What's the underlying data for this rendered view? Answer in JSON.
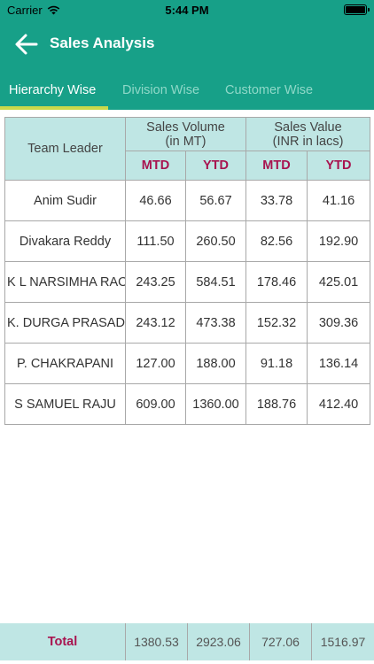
{
  "status": {
    "carrier": "Carrier",
    "time": "5:44 PM"
  },
  "header": {
    "title": "Sales Analysis"
  },
  "tabs": [
    {
      "label": "Hierarchy Wise"
    },
    {
      "label": "Division Wise"
    },
    {
      "label": "Customer Wise"
    }
  ],
  "table": {
    "team_leader_header": "Team Leader",
    "volume_header_line1": "Sales Volume",
    "volume_header_line2": "(in MT)",
    "value_header_line1": "Sales Value",
    "value_header_line2": "(INR in lacs)",
    "mtd_label": "MTD",
    "ytd_label": "YTD",
    "rows": [
      {
        "name": "Anim Sudir",
        "vol_mtd": "46.66",
        "vol_ytd": "56.67",
        "val_mtd": "33.78",
        "val_ytd": "41.16"
      },
      {
        "name": "Divakara Reddy",
        "vol_mtd": "111.50",
        "vol_ytd": "260.50",
        "val_mtd": "82.56",
        "val_ytd": "192.90"
      },
      {
        "name": "K L NARSIMHA RAO",
        "vol_mtd": "243.25",
        "vol_ytd": "584.51",
        "val_mtd": "178.46",
        "val_ytd": "425.01"
      },
      {
        "name": "K. DURGA PRASAD",
        "vol_mtd": "243.12",
        "vol_ytd": "473.38",
        "val_mtd": "152.32",
        "val_ytd": "309.36"
      },
      {
        "name": "P. CHAKRAPANI",
        "vol_mtd": "127.00",
        "vol_ytd": "188.00",
        "val_mtd": "91.18",
        "val_ytd": "136.14"
      },
      {
        "name": "S SAMUEL RAJU",
        "vol_mtd": "609.00",
        "vol_ytd": "1360.00",
        "val_mtd": "188.76",
        "val_ytd": "412.40"
      }
    ]
  },
  "totals": {
    "label": "Total",
    "vol_mtd": "1380.53",
    "vol_ytd": "2923.06",
    "val_mtd": "727.06",
    "val_ytd": "1516.97"
  },
  "colors": {
    "header_bg": "#17a088",
    "tab_indicator": "#c9d94a",
    "table_header_bg": "#bfe6e4",
    "accent_label": "#a8134f"
  },
  "icons": {
    "back": "arrow-left-icon",
    "wifi": "wifi-icon",
    "battery": "battery-icon"
  }
}
